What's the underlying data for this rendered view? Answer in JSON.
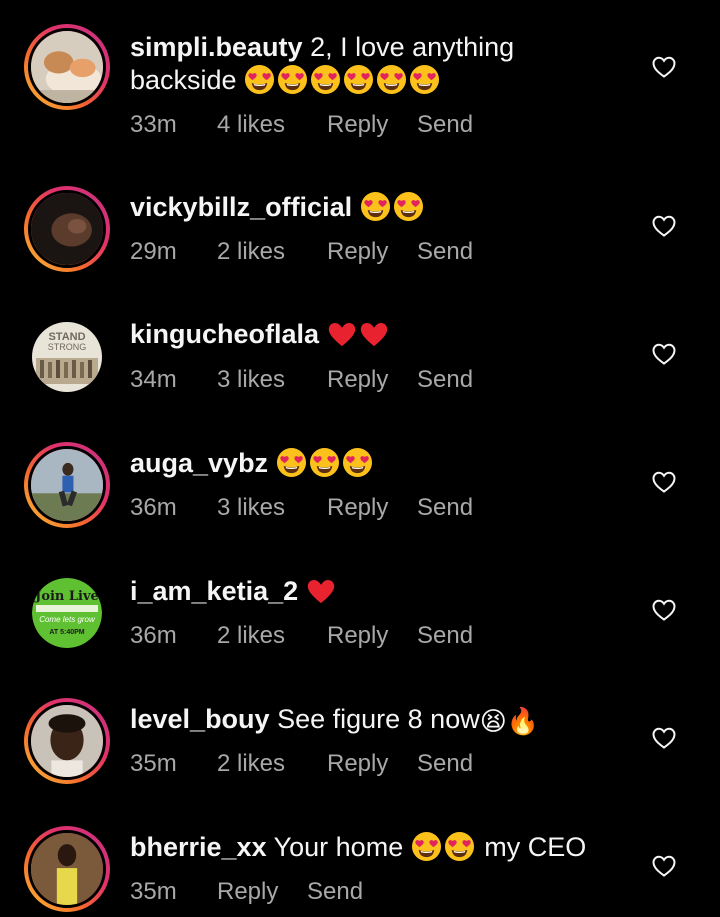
{
  "comments": [
    {
      "username": "simpli.beauty",
      "text": "2, I love anything",
      "text_line2": "backside",
      "emoji_line2": [
        "heart-eyes",
        "heart-eyes",
        "heart-eyes",
        "heart-eyes",
        "heart-eyes",
        "heart-eyes"
      ],
      "time": "33m",
      "likes": "4 likes",
      "reply": "Reply",
      "send": "Send"
    },
    {
      "username": "vickybillz_official",
      "emojis": [
        "heart-eyes",
        "heart-eyes"
      ],
      "time": "29m",
      "likes": "2 likes",
      "reply": "Reply",
      "send": "Send"
    },
    {
      "username": "kingucheoflala",
      "emojis": [
        "red-heart",
        "red-heart"
      ],
      "time": "34m",
      "likes": "3 likes",
      "reply": "Reply",
      "send": "Send",
      "avatar_text": "STAND STRONG"
    },
    {
      "username": "auga_vybz",
      "emojis": [
        "heart-eyes",
        "heart-eyes",
        "heart-eyes"
      ],
      "time": "36m",
      "likes": "3 likes",
      "reply": "Reply",
      "send": "Send"
    },
    {
      "username": "i_am_ketia_2",
      "emojis": [
        "red-heart"
      ],
      "time": "36m",
      "likes": "2 likes",
      "reply": "Reply",
      "send": "Send",
      "avatar_text_1": "Join Live",
      "avatar_text_2": "Come lets grow",
      "avatar_text_3": "AT 5:40PM"
    },
    {
      "username": "level_bouy",
      "text": "See figure 8 now",
      "emojis": [
        "tired-face",
        "fire"
      ],
      "emoji_glyphs": [
        "😫",
        "🔥"
      ],
      "time": "35m",
      "likes": "2 likes",
      "reply": "Reply",
      "send": "Send"
    },
    {
      "username": "bherrie_xx",
      "text": "Your home",
      "emojis": [
        "heart-eyes",
        "heart-eyes"
      ],
      "text_after": "my CEO",
      "time": "35m",
      "reply": "Reply",
      "send": "Send"
    }
  ],
  "colors": {
    "background": "#000000",
    "primary_text": "#f5f5f5",
    "secondary_text": "#a8a8a8",
    "heart": "#e0245e"
  }
}
